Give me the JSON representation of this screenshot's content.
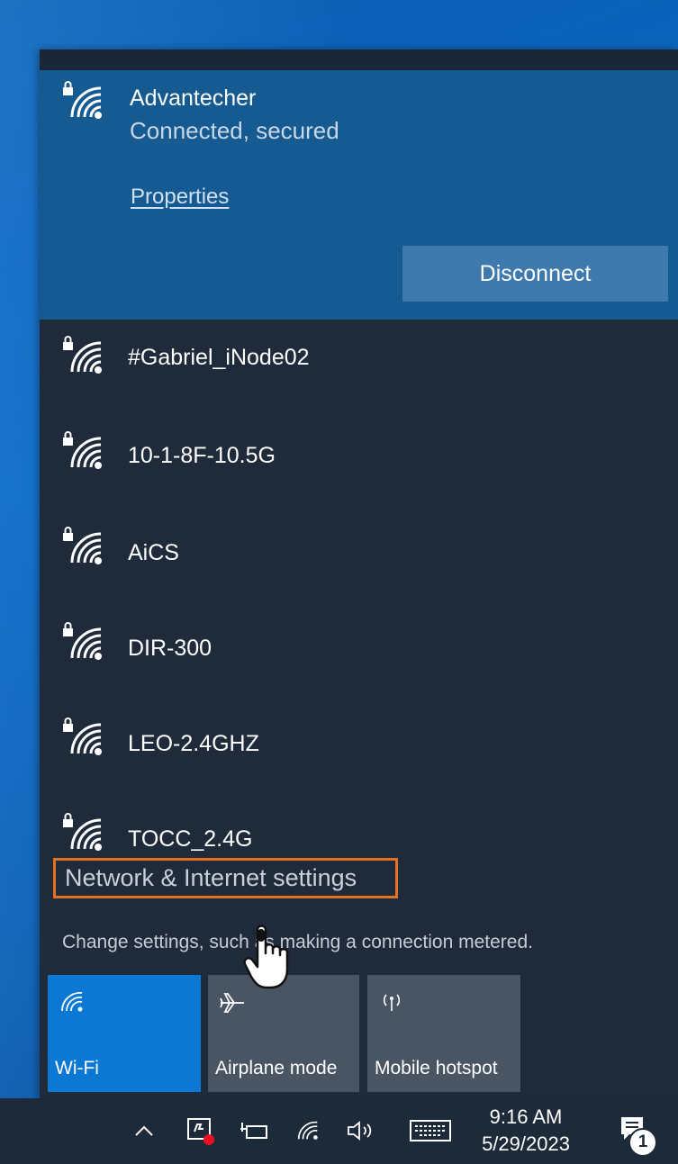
{
  "connected_network": {
    "name": "Advantecher",
    "status": "Connected, secured",
    "properties_label": "Properties",
    "disconnect_label": "Disconnect",
    "icon": "wifi-secured-icon"
  },
  "networks": [
    {
      "name": "#Gabriel_iNode02",
      "icon": "wifi-secured-icon"
    },
    {
      "name": "10-1-8F-10.5G",
      "icon": "wifi-secured-icon"
    },
    {
      "name": "AiCS",
      "icon": "wifi-secured-icon"
    },
    {
      "name": "DIR-300",
      "icon": "wifi-secured-icon"
    },
    {
      "name": "LEO-2.4GHZ",
      "icon": "wifi-secured-icon"
    },
    {
      "name": "TOCC_2.4G",
      "icon": "wifi-secured-icon"
    }
  ],
  "settings": {
    "link_label": "Network & Internet settings",
    "description": "Change settings, such as making a connection metered.",
    "highlight_color": "#e37322"
  },
  "quick_actions": [
    {
      "label": "Wi-Fi",
      "icon": "wifi-icon",
      "active": true
    },
    {
      "label": "Airplane mode",
      "icon": "airplane-icon",
      "active": false
    },
    {
      "label": "Mobile hotspot",
      "icon": "hotspot-icon",
      "active": false
    }
  ],
  "taskbar": {
    "time": "9:16 AM",
    "date": "5/29/2023",
    "notification_count": "1",
    "icons": [
      "chevron-up-icon",
      "meet-now-icon",
      "battery-icon",
      "wifi-icon",
      "volume-icon",
      "keyboard-icon",
      "action-center-icon"
    ]
  },
  "colors": {
    "flyout_bg": "#1f2b3b",
    "connected_bg": "#155a90",
    "accent": "#0b78d4",
    "tile_inactive": "#4a5564",
    "desktop": "#0a67c4"
  }
}
